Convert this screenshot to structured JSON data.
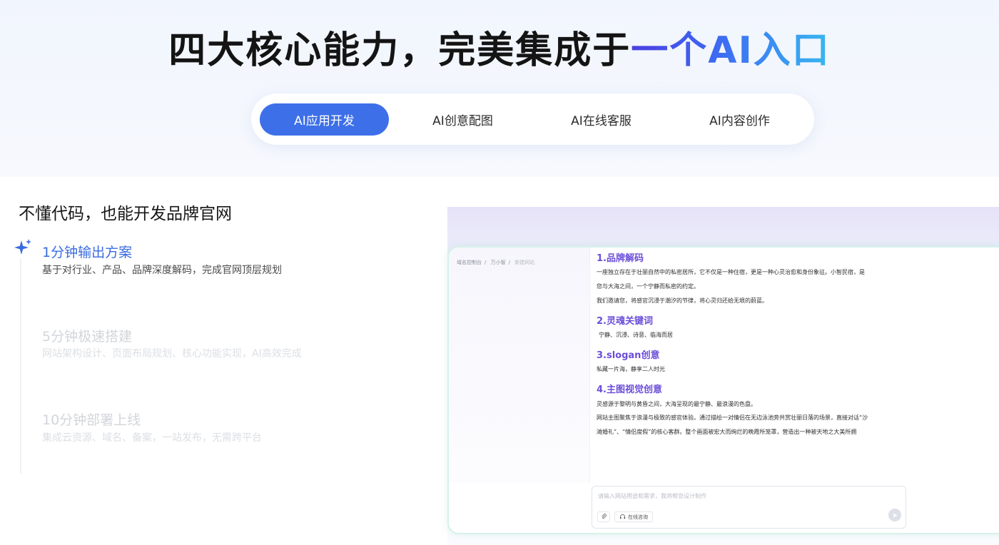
{
  "hero": {
    "title_main": "四大核心能力，完美集成于",
    "title_highlight": "一个AI入口"
  },
  "tabs": [
    {
      "label": "AI应用开发",
      "active": true
    },
    {
      "label": "AI创意配图",
      "active": false
    },
    {
      "label": "AI在线客服",
      "active": false
    },
    {
      "label": "AI内容创作",
      "active": false
    }
  ],
  "feature": {
    "title": "不懂代码，也能开发品牌官网",
    "steps": [
      {
        "title": "1分钟输出方案",
        "desc": "基于对行业、产品、品牌深度解码，完成官网顶层规划",
        "active": true
      },
      {
        "title": "5分钟极速搭建",
        "desc": "网站架构设计、页面布局规划、核心功能实现，AI高效完成",
        "active": false
      },
      {
        "title": "10分钟部署上线",
        "desc": "集成云资源、域名、备案，一站发布，无需跨平台",
        "active": false
      }
    ]
  },
  "mock": {
    "breadcrumb": [
      "域名控制台",
      "万小智",
      "新建网站"
    ],
    "sections": [
      {
        "heading": "1.品牌解码",
        "lines": [
          "一座独立存在于壮丽自然中的私密居所，它不仅是一种住宿，更是一种心灵治愈和身份象征。小智民宿，是",
          "您与大海之间，一个宁静而私密的约定。",
          "我们邀请您，将感官沉浸于潮汐的节律，将心灵归还给无垠的蔚蓝。"
        ]
      },
      {
        "heading": "2.灵魂关键词",
        "lines": [
          "宁静、沉浸、诗意、临海而居"
        ]
      },
      {
        "heading": "3.slogan创意",
        "lines": [
          "私藏一片海，静享二人时光"
        ]
      },
      {
        "heading": "4.主图视觉创意",
        "lines": [
          "灵感源于黎明与黄昏之间，大海呈现的最宁静、最浪漫的色盘。",
          "网站主图聚焦于浪漫与极致的感官体验。通过描绘一对情侣在无边泳池旁共赏壮丽日落的场景，直接对话“沙",
          "滩婚礼”、“情侣度假”的核心客群。整个画面被宏大而绚烂的晚霞所笼罩，营造出一种被天地之大美所拥"
        ]
      }
    ],
    "input_placeholder": "请输入网站用途和需求，我将帮您设计制作",
    "service_label": "在线咨询"
  },
  "colors": {
    "accent": "#3d6fe8",
    "active_step": "#3a6be0",
    "mock_heading": "#6b4ed8"
  }
}
